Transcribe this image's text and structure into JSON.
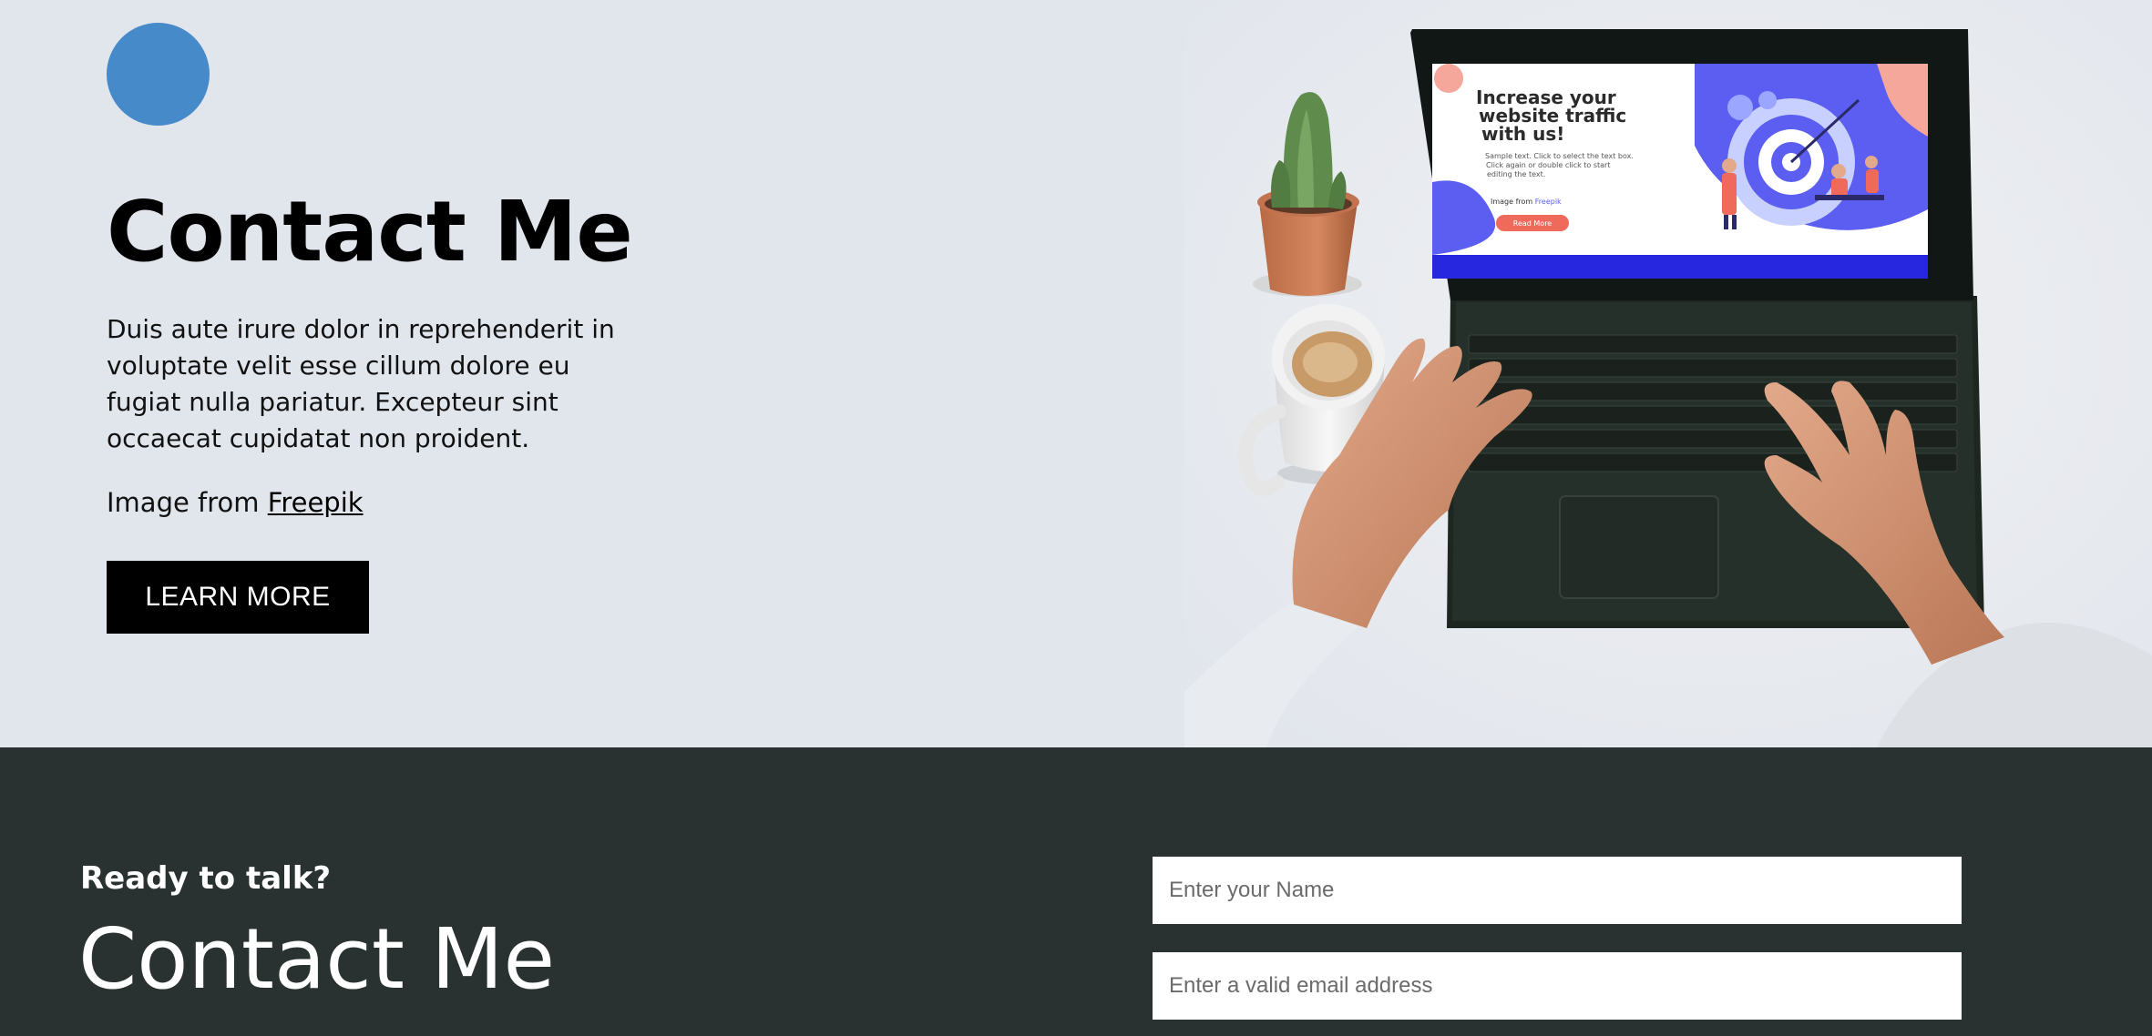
{
  "hero": {
    "title": "Contact Me",
    "body": "Duis aute irure dolor in reprehenderit in voluptate velit esse cillum dolore eu fugiat nulla pariatur. Excepteur sint occaecat cupidatat non proident.",
    "credit_prefix": "Image from ",
    "credit_link": "Freepik",
    "button_label": "LEARN MORE"
  },
  "laptop_screen": {
    "headline_1": "Increase your",
    "headline_2": "website traffic",
    "headline_3": "with us!",
    "text_1": "Sample text. Click to select the text box.",
    "text_2": "Click again or double click to start",
    "text_3": "editing the text.",
    "credit_prefix": "Image from ",
    "credit_link": "Freepik",
    "button": "Read More"
  },
  "contact": {
    "subtitle": "Ready to talk?",
    "title": "Contact Me",
    "name_placeholder": "Enter your Name",
    "email_placeholder": "Enter a valid email address"
  },
  "colors": {
    "hero_bg": "#e1e5ec",
    "accent": "#478ac9",
    "contact_bg": "#293131",
    "button_bg": "#000000"
  }
}
